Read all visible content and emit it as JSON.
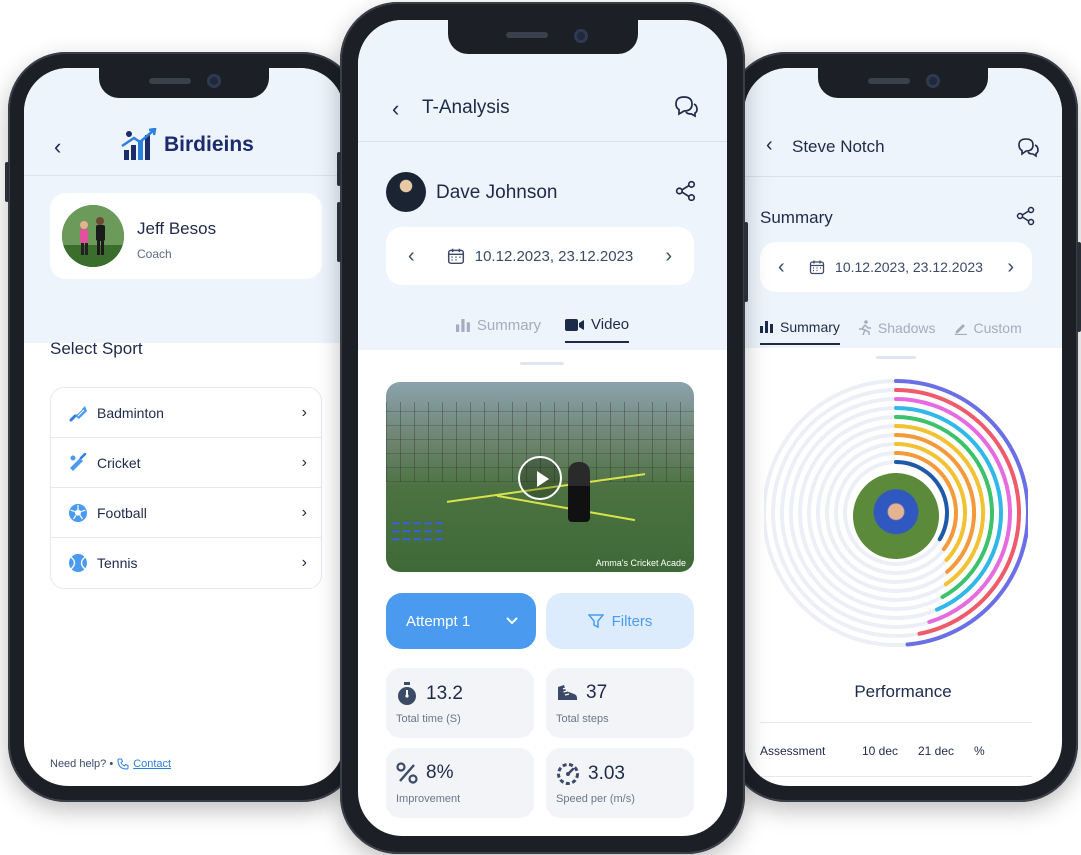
{
  "left_screen": {
    "brand": "Birdieins",
    "profile": {
      "name": "Jeff Besos",
      "role": "Coach"
    },
    "section_title": "Select Sport",
    "sports": [
      {
        "label": "Badminton",
        "icon": "shuttlecock-icon"
      },
      {
        "label": "Cricket",
        "icon": "cricket-bat-icon"
      },
      {
        "label": "Football",
        "icon": "football-icon"
      },
      {
        "label": "Tennis",
        "icon": "tennis-ball-icon"
      }
    ],
    "help_text": "Need help? •",
    "contact_label": "Contact"
  },
  "center_screen": {
    "title": "T-Analysis",
    "athlete_name": "Dave Johnson",
    "date_range": "10.12.2023, 23.12.2023",
    "tabs": [
      {
        "label": "Summary",
        "icon": "bar-chart-icon",
        "active": false
      },
      {
        "label": "Video",
        "icon": "video-camera-icon",
        "active": true
      }
    ],
    "video_watermark": "Amma's Cricket Acade",
    "attempt_label": "Attempt 1",
    "filters_label": "Filters",
    "stats": [
      {
        "value": "13.2",
        "label": "Total time (S)",
        "icon": "stopwatch-icon"
      },
      {
        "value": "37",
        "label": "Total steps",
        "icon": "shoe-icon"
      },
      {
        "value": "8%",
        "label": "Improvement",
        "icon": "percent-icon"
      },
      {
        "value": "3.03",
        "label": "Speed per (m/s)",
        "icon": "speedometer-icon"
      }
    ]
  },
  "right_screen": {
    "title": "Steve Notch",
    "section_title": "Summary",
    "date_range": "10.12.2023, 23.12.2023",
    "tabs": [
      {
        "label": "Summary",
        "icon": "bar-chart-icon",
        "active": true
      },
      {
        "label": "Shadows",
        "icon": "running-figure-icon",
        "active": false
      },
      {
        "label": "Custom",
        "icon": "pencil-icon",
        "active": false
      }
    ],
    "ring_colors": [
      "#6b6fe6",
      "#ef5b6b",
      "#e76be0",
      "#2fb8e8",
      "#3cc26a",
      "#f2c232",
      "#f59a3a",
      "#f2c232",
      "#f59a3a",
      "#1e5aa8"
    ],
    "performance_title": "Performance",
    "table_header": [
      "Assessment",
      "10 dec",
      "21 dec",
      "%"
    ]
  },
  "colors": {
    "accent": "#4a9bf0",
    "brand": "#1c2b6b",
    "text": "#1e2a4a"
  }
}
